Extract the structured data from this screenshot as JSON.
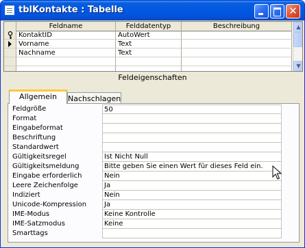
{
  "window": {
    "title": "tblKontakte : Tabelle"
  },
  "grid": {
    "headers": [
      "Feldname",
      "Felddatentyp",
      "Beschreibung"
    ],
    "rows": [
      {
        "indicator": "key-icon",
        "name": "KontaktID",
        "type": "AutoWert",
        "desc": ""
      },
      {
        "indicator": "current-row-icon",
        "name": "Vorname",
        "type": "Text",
        "desc": ""
      },
      {
        "indicator": "",
        "name": "Nachname",
        "type": "Text",
        "desc": ""
      },
      {
        "indicator": "",
        "name": "",
        "type": "",
        "desc": ""
      },
      {
        "indicator": "",
        "name": "",
        "type": "",
        "desc": ""
      }
    ]
  },
  "section_label": "Feldeigenschaften",
  "tabs": [
    "Allgemein",
    "Nachschlagen"
  ],
  "properties": [
    {
      "label": "Feldgröße",
      "value": "50"
    },
    {
      "label": "Format",
      "value": ""
    },
    {
      "label": "Eingabeformat",
      "value": ""
    },
    {
      "label": "Beschriftung",
      "value": ""
    },
    {
      "label": "Standardwert",
      "value": ""
    },
    {
      "label": "Gültigkeitsregel",
      "value": "Ist Nicht Null"
    },
    {
      "label": "Gültigkeitsmeldung",
      "value": "Bitte geben Sie einen Wert für dieses Feld ein."
    },
    {
      "label": "Eingabe erforderlich",
      "value": "Nein"
    },
    {
      "label": "Leere Zeichenfolge",
      "value": "Ja"
    },
    {
      "label": "Indiziert",
      "value": "Nein"
    },
    {
      "label": "Unicode-Kompression",
      "value": "Ja"
    },
    {
      "label": "IME-Modus",
      "value": "Keine Kontrolle"
    },
    {
      "label": "IME-Satzmodus",
      "value": "Keine"
    },
    {
      "label": "Smarttags",
      "value": ""
    }
  ]
}
